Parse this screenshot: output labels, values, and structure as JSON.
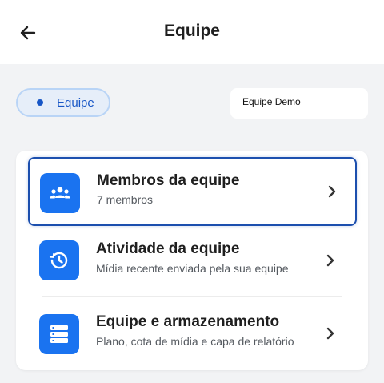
{
  "header": {
    "title": "Equipe"
  },
  "chip": {
    "label": "Equipe"
  },
  "team": {
    "name": "Equipe Demo"
  },
  "menu": {
    "items": [
      {
        "title": "Membros da equipe",
        "subtitle": "7 membros"
      },
      {
        "title": "Atividade da equipe",
        "subtitle": "Mídia recente enviada pela sua equipe"
      },
      {
        "title": "Equipe e armazenamento",
        "subtitle": "Plano, cota de mídia e capa de relatório"
      }
    ]
  },
  "icons": {
    "back": "arrow-left-icon",
    "members": "people-group-icon",
    "activity": "history-clock-icon",
    "storage": "storage-list-icon",
    "chevron": "chevron-right-icon"
  },
  "colors": {
    "accent": "#1a73f0",
    "chip_text": "#1756c6",
    "chip_bg": "#e6eef9",
    "focus_border": "#1c4fae"
  }
}
